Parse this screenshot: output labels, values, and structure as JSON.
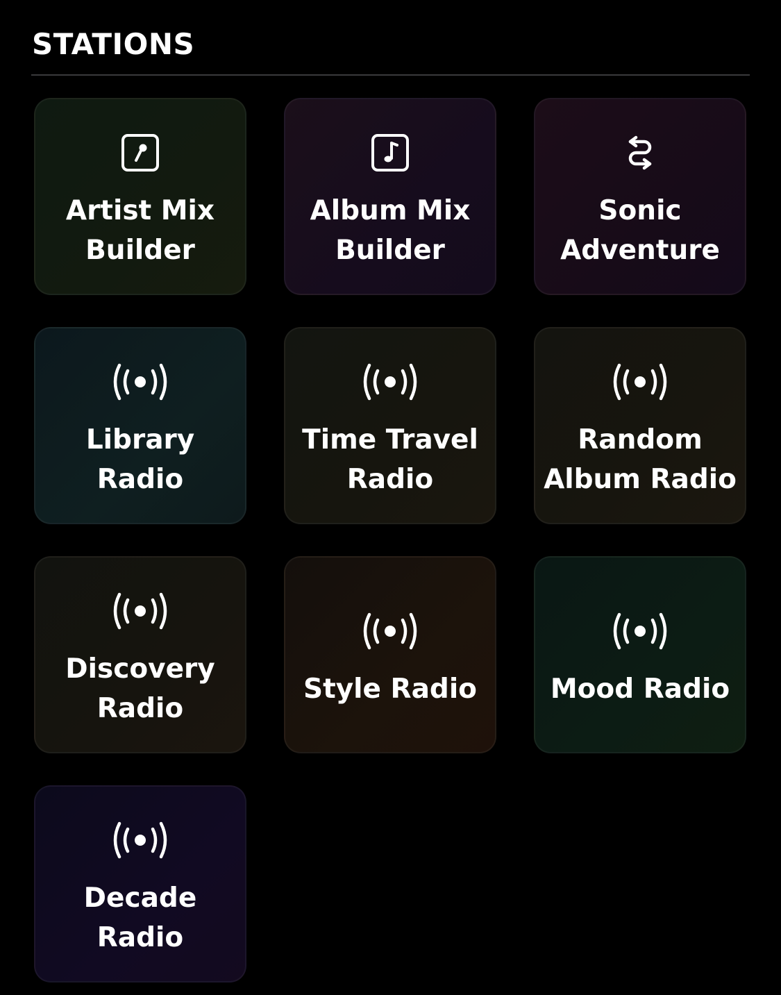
{
  "section": {
    "title": "STATIONS"
  },
  "tiles": [
    {
      "label": "Artist Mix\nBuilder",
      "icon": "microphone-square-icon"
    },
    {
      "label": "Album Mix\nBuilder",
      "icon": "music-note-square-icon"
    },
    {
      "label": "Sonic\nAdventure",
      "icon": "swap-arrows-icon"
    },
    {
      "label": "Library\nRadio",
      "icon": "broadcast-icon"
    },
    {
      "label": "Time Travel\nRadio",
      "icon": "broadcast-icon"
    },
    {
      "label": "Random\nAlbum Radio",
      "icon": "broadcast-icon"
    },
    {
      "label": "Discovery\nRadio",
      "icon": "broadcast-icon"
    },
    {
      "label": "Style Radio",
      "icon": "broadcast-icon"
    },
    {
      "label": "Mood Radio",
      "icon": "broadcast-icon"
    },
    {
      "label": "Decade\nRadio",
      "icon": "broadcast-icon"
    }
  ],
  "colors": {
    "background": "#000000",
    "text": "#ffffff",
    "divider": "#3a3a3c"
  }
}
